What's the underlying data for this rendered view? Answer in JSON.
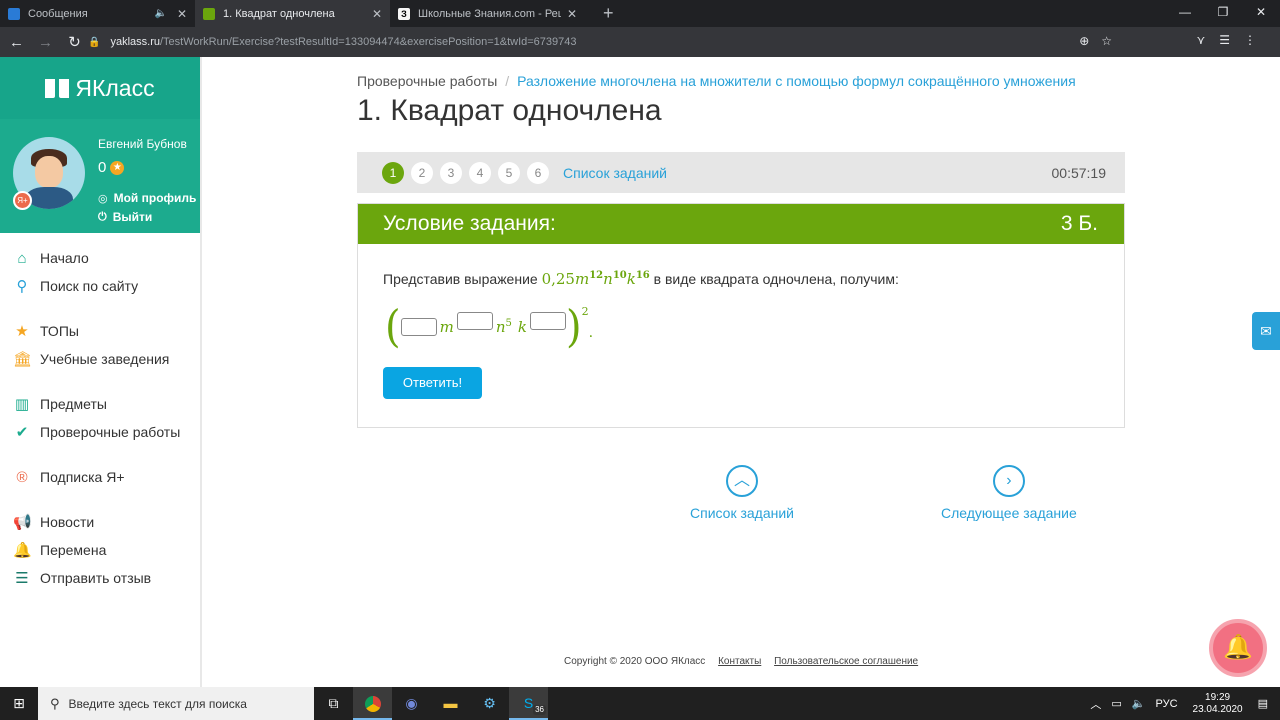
{
  "browser": {
    "tabs": [
      {
        "title": "Сообщения",
        "active": false,
        "fav_color": "#2a7bd6"
      },
      {
        "title": "1. Квадрат одночлена",
        "active": true,
        "fav_color": "#6ba60d"
      },
      {
        "title": "Школьные Знания.com - Решае",
        "active": false,
        "fav_color": "#1a1a1a"
      }
    ],
    "url_host": "yaklass.ru",
    "url_path": "/TestWorkRun/Exercise?testResultId=133094474&exercisePosition=1&twId=6739743"
  },
  "sidebar": {
    "brand": "ЯКласс",
    "user_name": "Евгений Бубнов",
    "points": "0",
    "profile_link": "Мой профиль",
    "logout_link": "Выйти",
    "ya_badge": "Я+",
    "items": [
      {
        "label": "Начало",
        "icon": "home-icon"
      },
      {
        "label": "Поиск по сайту",
        "icon": "search-icon"
      },
      {
        "label": "ТОПы",
        "icon": "star-icon"
      },
      {
        "label": "Учебные заведения",
        "icon": "institution-icon"
      },
      {
        "label": "Предметы",
        "icon": "book-icon"
      },
      {
        "label": "Проверочные работы",
        "icon": "check-icon"
      },
      {
        "label": "Подписка Я+",
        "icon": "ya-plus-icon"
      },
      {
        "label": "Новости",
        "icon": "megaphone-icon"
      },
      {
        "label": "Перемена",
        "icon": "bell-icon"
      },
      {
        "label": "Отправить отзыв",
        "icon": "feedback-icon"
      }
    ]
  },
  "main": {
    "breadcrumb_root": "Проверочные работы",
    "breadcrumb_link": "Разложение многочлена на множители с помощью формул сокращённого умножения",
    "title": "1. Квадрат одночлена",
    "questions": [
      "1",
      "2",
      "3",
      "4",
      "5",
      "6"
    ],
    "current_question": "1",
    "question_list_link": "Список заданий",
    "timer": "00:57:19",
    "task_header": "Условие задания:",
    "task_points": "3 Б.",
    "task_text_before": "Представив выражение",
    "task_text_after": "в виде квадрата одночлена, получим:",
    "expression": {
      "coef": "0,25",
      "v1": "m",
      "e1": "12",
      "v2": "n",
      "e2": "10",
      "v3": "k",
      "e3": "16"
    },
    "answer_template": {
      "v1": "m",
      "v2": "n",
      "e2": "5",
      "v3": "k",
      "outer_exp": "2",
      "period": "."
    },
    "answer_inputs": [
      "",
      "",
      ""
    ],
    "submit_label": "Ответить!",
    "nav_list_label": "Список заданий",
    "nav_next_label": "Следующее задание"
  },
  "footer": {
    "copyright": "Copyright © 2020 ООО ЯКласс",
    "contacts": "Контакты",
    "agreement": "Пользовательское соглашение"
  },
  "taskbar": {
    "search_placeholder": "Введите здесь текст для поиска",
    "skype_badge": "36",
    "lang": "РУС",
    "time": "19:29",
    "date": "23.04.2020"
  },
  "colors": {
    "accent_green": "#6ba60d",
    "brand_teal": "#17a58a",
    "link_blue": "#29a1d8",
    "button_blue": "#0aa5e2"
  }
}
